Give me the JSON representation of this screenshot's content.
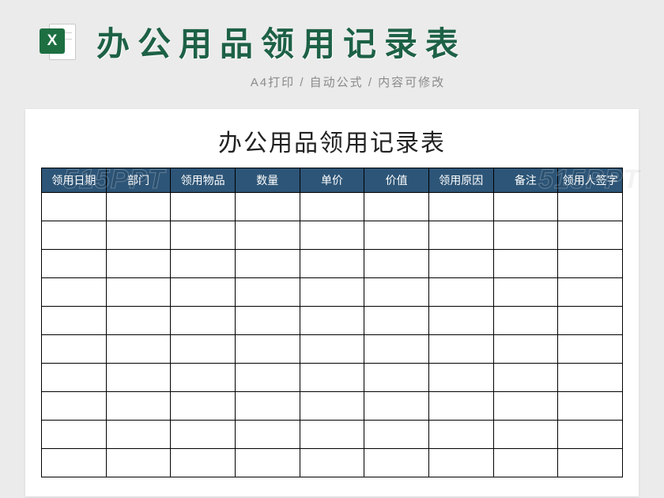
{
  "header": {
    "icon_letter": "X",
    "title": "办公用品领用记录表",
    "subtitle": "A4打印 / 自动公式 / 内容可修改"
  },
  "sheet": {
    "title": "办公用品领用记录表",
    "columns": [
      "领用日期",
      "部门",
      "领用物品",
      "数量",
      "单价",
      "价值",
      "领用原因",
      "备注",
      "领用人签字"
    ],
    "row_count": 10
  },
  "watermark": "515PPT"
}
